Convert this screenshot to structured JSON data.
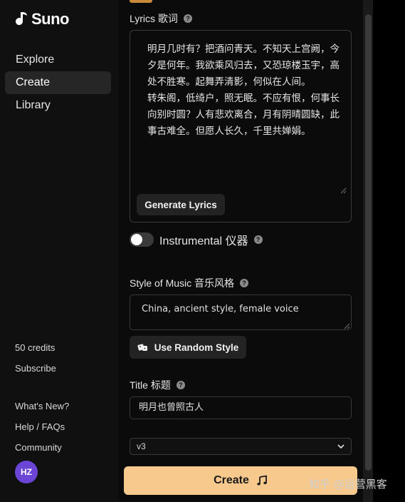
{
  "brand": {
    "name": "Suno"
  },
  "nav": [
    {
      "label": "Explore"
    },
    {
      "label": "Create"
    },
    {
      "label": "Library"
    }
  ],
  "account": {
    "credits": "50 credits",
    "subscribe": "Subscribe",
    "links": [
      "What's New?",
      "Help / FAQs",
      "Community"
    ],
    "avatar_initials": "HZ"
  },
  "lyrics": {
    "label": "Lyrics 歌词",
    "value": "明月几时有？把酒问青天。不知天上宫阙，今夕是何年。我欲乘风归去，又恐琼楼玉宇，高处不胜寒。起舞弄清影，何似在人间。\n转朱阁，低绮户，照无眠。不应有恨，何事长向别时圆？人有悲欢离合，月有阴晴圆缺，此事古难全。但愿人长久，千里共婵娟。",
    "generate_button": "Generate Lyrics"
  },
  "instrumental": {
    "label": "Instrumental 仪器",
    "enabled": false
  },
  "style": {
    "label": "Style of Music 音乐风格",
    "value": "China, ancient style, female voice",
    "random_button": "Use Random Style"
  },
  "title_field": {
    "label": "Title 标题",
    "value": "明月也曾照古人"
  },
  "version": {
    "selected": "v3"
  },
  "create_button": "Create",
  "watermark": "知乎 @运营黑客",
  "colors": {
    "accent": "#f7c98c",
    "avatar": "#6b46d6"
  }
}
